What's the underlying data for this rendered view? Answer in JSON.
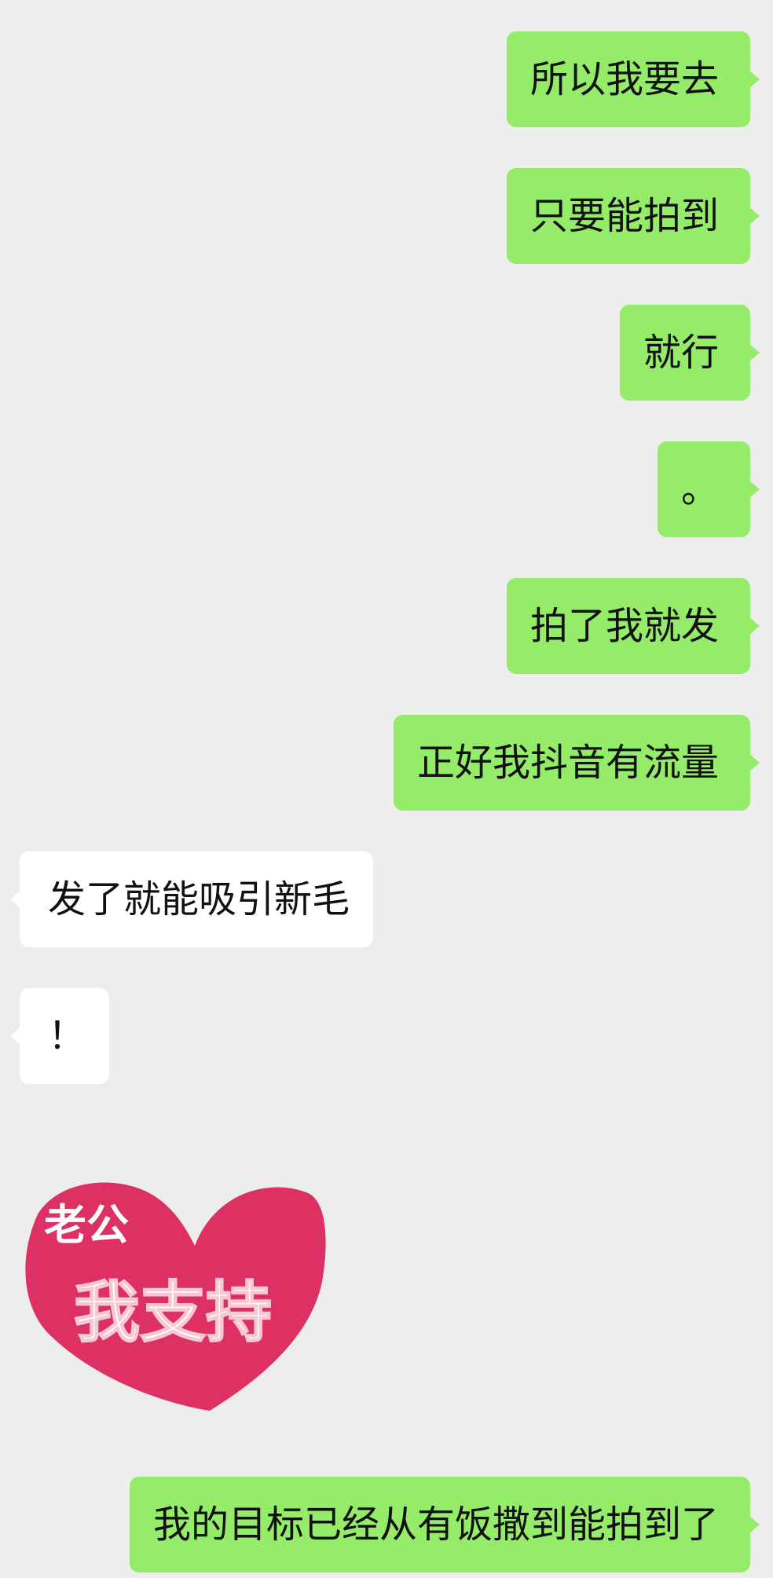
{
  "messages": [
    {
      "sender": "me",
      "text": "所以我要去"
    },
    {
      "sender": "me",
      "text": "只要能拍到"
    },
    {
      "sender": "me",
      "text": "就行"
    },
    {
      "sender": "me",
      "text": "。"
    },
    {
      "sender": "me",
      "text": "拍了我就发"
    },
    {
      "sender": "me",
      "text": "正好我抖音有流量"
    },
    {
      "sender": "other",
      "text": "发了就能吸引新毛"
    },
    {
      "sender": "other",
      "text": "！"
    },
    {
      "sender": "other",
      "type": "sticker",
      "line1": "老公",
      "line2": "我支持"
    },
    {
      "sender": "me",
      "text": "我的目标已经从有饭撒到能拍到了"
    }
  ],
  "colors": {
    "background": "#ededed",
    "sent_bubble": "#95ec69",
    "received_bubble": "#ffffff",
    "sticker_heart": "#dc3162",
    "text": "#111111"
  }
}
